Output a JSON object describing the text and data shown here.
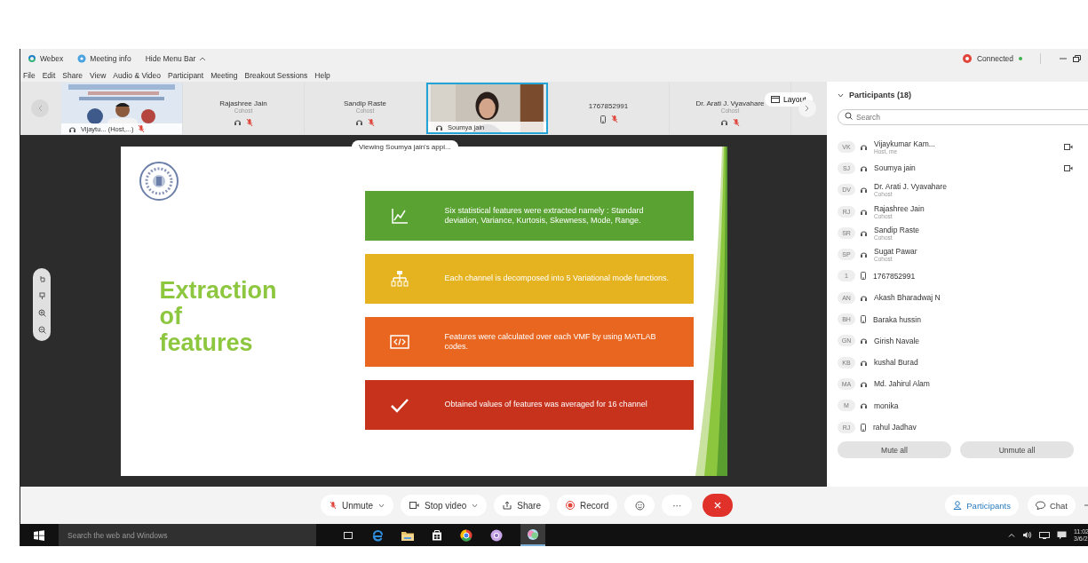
{
  "app_bar": {
    "app": "Webex",
    "meeting_info": "Meeting info",
    "hide_menu": "Hide Menu Bar",
    "status": "Connected"
  },
  "menu": [
    "File",
    "Edit",
    "Share",
    "View",
    "Audio & Video",
    "Participant",
    "Meeting",
    "Breakout Sessions",
    "Help"
  ],
  "video_strip": {
    "tiles": [
      {
        "kind": "video",
        "name": "Vijaytu... (Host,...)",
        "muted": true,
        "selected": false
      },
      {
        "kind": "avatar",
        "name": "Rajashree Jain",
        "role": "Cohost",
        "muted": true,
        "selected": false
      },
      {
        "kind": "avatar",
        "name": "Sandip Raste",
        "role": "Cohost",
        "muted": true,
        "selected": false
      },
      {
        "kind": "video",
        "name": "Soumya jain",
        "muted": false,
        "selected": true
      },
      {
        "kind": "phone",
        "name": "1767852991",
        "muted": true,
        "selected": false
      },
      {
        "kind": "avatar",
        "name": "Dr. Arati J. Vyavahare",
        "role": "Cohost",
        "muted": true,
        "selected": false
      }
    ],
    "layout_button": "Layout"
  },
  "sharing_banner": "Viewing Soumya jain's appi...",
  "slide": {
    "title": "Extraction of features",
    "items": [
      {
        "kind": "chart",
        "color": "#5aa232",
        "text": "Six statistical features were extracted namely : Standard deviation, Variance, Kurtosis, Skewness, Mode, Range."
      },
      {
        "kind": "hierarchy",
        "color": "#e5b320",
        "text": "Each channel is decomposed into 5 Variational mode functions."
      },
      {
        "kind": "code",
        "color": "#e8661f",
        "text": "Features were calculated over each VMF by using MATLAB codes."
      },
      {
        "kind": "check",
        "color": "#c7321d",
        "text": "Obtained values of features was averaged for 16 channel"
      }
    ]
  },
  "participants": {
    "title": "Participants (18)",
    "search": {
      "placeholder": "Search"
    },
    "items": [
      {
        "initials": "VK",
        "name": "Vijaykumar Kam...",
        "role": "Host, me",
        "kind": "audio",
        "video": true
      },
      {
        "initials": "SJ",
        "name": "Soumya jain",
        "kind": "audio",
        "video": true
      },
      {
        "initials": "DV",
        "name": "Dr. Arati J. Vyavahare",
        "role": "Cohost",
        "kind": "audio",
        "video": false
      },
      {
        "initials": "RJ",
        "name": "Rajashree Jain",
        "role": "Cohost",
        "kind": "audio",
        "video": false
      },
      {
        "initials": "SR",
        "name": "Sandip Raste",
        "role": "Cohost",
        "kind": "audio",
        "video": false
      },
      {
        "initials": "SP",
        "name": "Sugat Pawar",
        "role": "Cohost",
        "kind": "audio",
        "video": false
      },
      {
        "initials": "1",
        "name": "1767852991",
        "kind": "phone",
        "video": false
      },
      {
        "initials": "AN",
        "name": "Akash Bharadwaj N",
        "kind": "audio",
        "video": false
      },
      {
        "initials": "BH",
        "name": "Baraka hussin",
        "kind": "phone",
        "video": false
      },
      {
        "initials": "GN",
        "name": "Girish Navale",
        "kind": "audio",
        "video": false
      },
      {
        "initials": "KB",
        "name": "kushal Burad",
        "kind": "audio",
        "video": false
      },
      {
        "initials": "MA",
        "name": "Md. Jahirul Alam",
        "kind": "audio",
        "video": false
      },
      {
        "initials": "M",
        "name": "monika",
        "kind": "audio",
        "video": false
      },
      {
        "initials": "RJ",
        "name": "rahul Jadhav",
        "kind": "phone",
        "video": false
      }
    ],
    "buttons": [
      "Mute all",
      "Unmute all"
    ]
  },
  "toolbar": {
    "buttons": [
      {
        "kind": "unmute",
        "label": "Unmute"
      },
      {
        "kind": "video",
        "label": "Stop video"
      },
      {
        "kind": "share",
        "label": "Share"
      },
      {
        "kind": "record",
        "label": "Record"
      },
      {
        "kind": "reactions"
      },
      {
        "kind": "more",
        "label": "···"
      },
      {
        "kind": "end"
      }
    ],
    "panels": [
      {
        "kind": "participants",
        "label": "Participants",
        "selected": true
      },
      {
        "kind": "chat",
        "label": "Chat",
        "selected": false
      }
    ]
  },
  "taskbar": {
    "search": {
      "placeholder": "Search the web and Windows"
    },
    "time": "11:02",
    "date": "3/6/2"
  }
}
